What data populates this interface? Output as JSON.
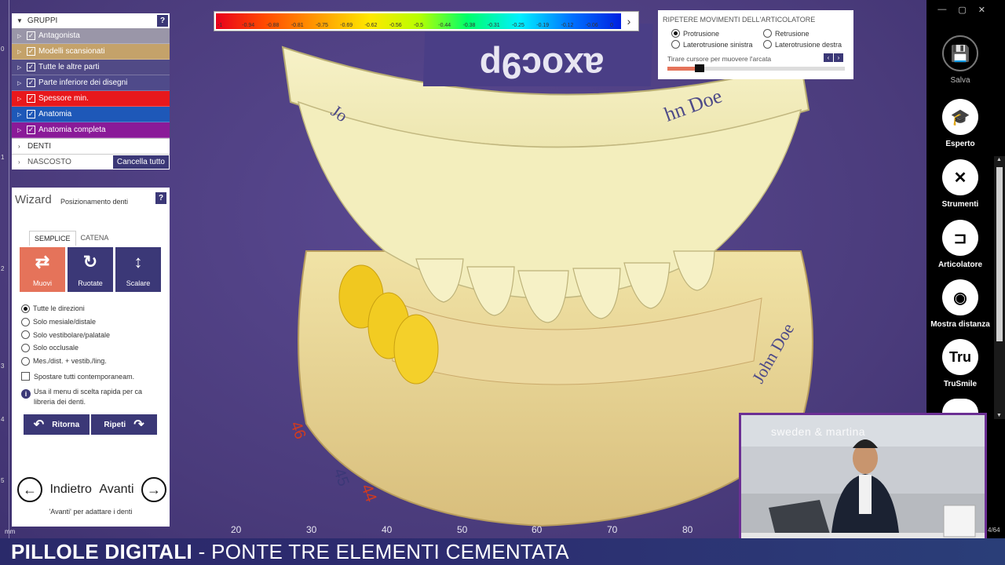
{
  "colors": {
    "accent": "#3b3877",
    "active": "#e5735a",
    "viewport_bg": "#4e3f82",
    "banner_bg": "#2a2a6a"
  },
  "color_scale": {
    "ticks": [
      "-1",
      "-0.94",
      "-0.88",
      "-0.81",
      "-0.75",
      "-0.69",
      "-0.62",
      "-0.56",
      "-0.5",
      "-0.44",
      "-0.38",
      "-0.31",
      "-0.25",
      "-0.19",
      "-0.12",
      "-0.06",
      "0"
    ],
    "expand_icon": "chevron-right-icon"
  },
  "groups": {
    "header": "GRUPPI",
    "help": "?",
    "items": [
      {
        "label": "Antagonista",
        "color": "#9a96a8",
        "checked": true
      },
      {
        "label": "Modelli scansionati",
        "color": "#c4a26a",
        "checked": true
      },
      {
        "label": "Tutte le altre parti",
        "color": "#514a86",
        "checked": true
      },
      {
        "label": "Parte inferiore dei disegni",
        "color": "#4f4a8a",
        "checked": true
      },
      {
        "label": "Spessore min.",
        "color": "#e8181c",
        "checked": true
      },
      {
        "label": "Anatomia",
        "color": "#1e58b8",
        "checked": true
      },
      {
        "label": "Anatomia completa",
        "color": "#8a1a98",
        "checked": true
      }
    ],
    "denti": "DENTI",
    "nascosto": "NASCOSTO",
    "cancel_all": "Cancella tutto"
  },
  "wizard": {
    "title": "Wizard",
    "subtitle": "Posizionamento denti",
    "help": "?",
    "tabs": [
      "SEMPLICE",
      "CATENA"
    ],
    "tools": [
      {
        "label": "Muovi",
        "icon": "move-arrows-icon"
      },
      {
        "label": "Ruotate",
        "icon": "rotate-icon"
      },
      {
        "label": "Scalare",
        "icon": "scale-arrows-icon"
      }
    ],
    "directions": [
      "Tutte le direzioni",
      "Solo mesiale/distale",
      "Solo vestibolare/palatale",
      "Solo occlusale",
      "Mes./dist. + vestib./ling."
    ],
    "move_all": "Spostare tutti contemporaneam.",
    "info": "Usa il menu di scelta rapida per ca libreria dei denti.",
    "undo": "Ritorna",
    "redo": "Ripeti",
    "back": "Indietro",
    "next": "Avanti",
    "hint": "'Avanti' per adattare i denti"
  },
  "articulator": {
    "title": "RIPETERE MOVIMENTI DELL'ARTICOLATORE",
    "options": [
      "Protrusione",
      "Retrusione",
      "Laterotrusione sinistra",
      "Laterotrusione destra"
    ],
    "selected": "Protrusione",
    "slider_hint": "Tirare cursore per muovere l'arcata",
    "slider_value": 0.18
  },
  "sidebar": {
    "items": [
      {
        "label": "Salva",
        "icon": "save-disk-icon"
      },
      {
        "label": "Esperto",
        "icon": "graduation-cap-icon"
      },
      {
        "label": "Strumenti",
        "icon": "tools-icon"
      },
      {
        "label": "Articolatore",
        "icon": "articulator-icon"
      },
      {
        "label": "Mostra distanza",
        "icon": "distance-icon"
      },
      {
        "label": "TruSmile",
        "icon": "trusmile-icon"
      }
    ],
    "window_controls": [
      "—",
      "▢",
      "✕"
    ]
  },
  "ruler": {
    "bottom_ticks": [
      "20",
      "30",
      "40",
      "50",
      "60",
      "70",
      "80"
    ],
    "bottom_unit": "mm",
    "left_labels": [
      "0",
      "1",
      "2",
      "3",
      "4",
      "5"
    ]
  },
  "video": {
    "brand": "sweden & martina",
    "counter": "4/64"
  },
  "banner": {
    "bold": "PILLOLE DIGITALI",
    "rest": " - PONTE TRE ELEMENTI CEMENTATA"
  }
}
